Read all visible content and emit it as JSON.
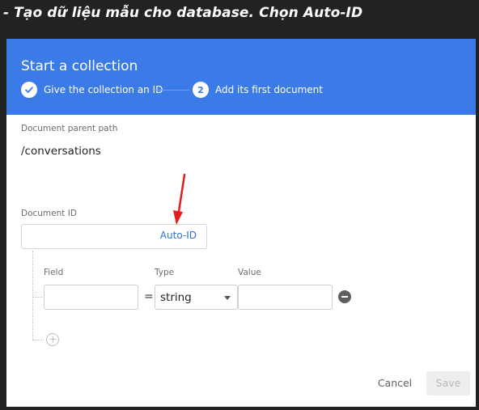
{
  "caption": "- Tạo dữ liệu mẫu cho database. Chọn Auto-ID",
  "dialog": {
    "title": "Start a collection",
    "steps": [
      {
        "number": "✓",
        "label": "Give the collection an ID",
        "state": "done"
      },
      {
        "number": "2",
        "label": "Add its first document",
        "state": "current"
      }
    ]
  },
  "form": {
    "parent_path_label": "Document parent path",
    "parent_path_value": "/conversations",
    "document_id_label": "Document ID",
    "document_id_value": "",
    "auto_id_label": "Auto-ID",
    "field_label": "Field",
    "type_label": "Type",
    "value_label": "Value",
    "field_value": "",
    "equals": "=",
    "type_value": "string",
    "value_value": ""
  },
  "footer": {
    "cancel_label": "Cancel",
    "save_label": "Save"
  },
  "colors": {
    "header": "#3b7be8",
    "accent_link": "#2f6fd6",
    "annotation_arrow": "#e31b1b"
  },
  "icons": {
    "step_done": "check-circle-icon",
    "remove_field": "remove-circle-icon",
    "add_field": "add-circle-icon",
    "type_dropdown": "caret-down-icon"
  }
}
